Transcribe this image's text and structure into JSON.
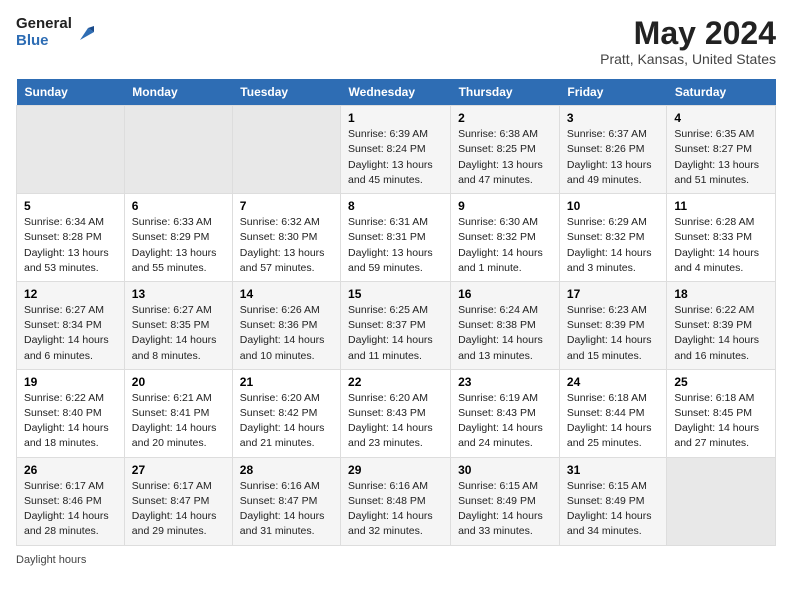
{
  "header": {
    "logo_general": "General",
    "logo_blue": "Blue",
    "month_year": "May 2024",
    "location": "Pratt, Kansas, United States"
  },
  "days_of_week": [
    "Sunday",
    "Monday",
    "Tuesday",
    "Wednesday",
    "Thursday",
    "Friday",
    "Saturday"
  ],
  "weeks": [
    [
      {
        "num": "",
        "info": "",
        "empty": true
      },
      {
        "num": "",
        "info": "",
        "empty": true
      },
      {
        "num": "",
        "info": "",
        "empty": true
      },
      {
        "num": "1",
        "info": "Sunrise: 6:39 AM\nSunset: 8:24 PM\nDaylight: 13 hours\nand 45 minutes.",
        "empty": false
      },
      {
        "num": "2",
        "info": "Sunrise: 6:38 AM\nSunset: 8:25 PM\nDaylight: 13 hours\nand 47 minutes.",
        "empty": false
      },
      {
        "num": "3",
        "info": "Sunrise: 6:37 AM\nSunset: 8:26 PM\nDaylight: 13 hours\nand 49 minutes.",
        "empty": false
      },
      {
        "num": "4",
        "info": "Sunrise: 6:35 AM\nSunset: 8:27 PM\nDaylight: 13 hours\nand 51 minutes.",
        "empty": false
      }
    ],
    [
      {
        "num": "5",
        "info": "Sunrise: 6:34 AM\nSunset: 8:28 PM\nDaylight: 13 hours\nand 53 minutes.",
        "empty": false
      },
      {
        "num": "6",
        "info": "Sunrise: 6:33 AM\nSunset: 8:29 PM\nDaylight: 13 hours\nand 55 minutes.",
        "empty": false
      },
      {
        "num": "7",
        "info": "Sunrise: 6:32 AM\nSunset: 8:30 PM\nDaylight: 13 hours\nand 57 minutes.",
        "empty": false
      },
      {
        "num": "8",
        "info": "Sunrise: 6:31 AM\nSunset: 8:31 PM\nDaylight: 13 hours\nand 59 minutes.",
        "empty": false
      },
      {
        "num": "9",
        "info": "Sunrise: 6:30 AM\nSunset: 8:32 PM\nDaylight: 14 hours\nand 1 minute.",
        "empty": false
      },
      {
        "num": "10",
        "info": "Sunrise: 6:29 AM\nSunset: 8:32 PM\nDaylight: 14 hours\nand 3 minutes.",
        "empty": false
      },
      {
        "num": "11",
        "info": "Sunrise: 6:28 AM\nSunset: 8:33 PM\nDaylight: 14 hours\nand 4 minutes.",
        "empty": false
      }
    ],
    [
      {
        "num": "12",
        "info": "Sunrise: 6:27 AM\nSunset: 8:34 PM\nDaylight: 14 hours\nand 6 minutes.",
        "empty": false
      },
      {
        "num": "13",
        "info": "Sunrise: 6:27 AM\nSunset: 8:35 PM\nDaylight: 14 hours\nand 8 minutes.",
        "empty": false
      },
      {
        "num": "14",
        "info": "Sunrise: 6:26 AM\nSunset: 8:36 PM\nDaylight: 14 hours\nand 10 minutes.",
        "empty": false
      },
      {
        "num": "15",
        "info": "Sunrise: 6:25 AM\nSunset: 8:37 PM\nDaylight: 14 hours\nand 11 minutes.",
        "empty": false
      },
      {
        "num": "16",
        "info": "Sunrise: 6:24 AM\nSunset: 8:38 PM\nDaylight: 14 hours\nand 13 minutes.",
        "empty": false
      },
      {
        "num": "17",
        "info": "Sunrise: 6:23 AM\nSunset: 8:39 PM\nDaylight: 14 hours\nand 15 minutes.",
        "empty": false
      },
      {
        "num": "18",
        "info": "Sunrise: 6:22 AM\nSunset: 8:39 PM\nDaylight: 14 hours\nand 16 minutes.",
        "empty": false
      }
    ],
    [
      {
        "num": "19",
        "info": "Sunrise: 6:22 AM\nSunset: 8:40 PM\nDaylight: 14 hours\nand 18 minutes.",
        "empty": false
      },
      {
        "num": "20",
        "info": "Sunrise: 6:21 AM\nSunset: 8:41 PM\nDaylight: 14 hours\nand 20 minutes.",
        "empty": false
      },
      {
        "num": "21",
        "info": "Sunrise: 6:20 AM\nSunset: 8:42 PM\nDaylight: 14 hours\nand 21 minutes.",
        "empty": false
      },
      {
        "num": "22",
        "info": "Sunrise: 6:20 AM\nSunset: 8:43 PM\nDaylight: 14 hours\nand 23 minutes.",
        "empty": false
      },
      {
        "num": "23",
        "info": "Sunrise: 6:19 AM\nSunset: 8:43 PM\nDaylight: 14 hours\nand 24 minutes.",
        "empty": false
      },
      {
        "num": "24",
        "info": "Sunrise: 6:18 AM\nSunset: 8:44 PM\nDaylight: 14 hours\nand 25 minutes.",
        "empty": false
      },
      {
        "num": "25",
        "info": "Sunrise: 6:18 AM\nSunset: 8:45 PM\nDaylight: 14 hours\nand 27 minutes.",
        "empty": false
      }
    ],
    [
      {
        "num": "26",
        "info": "Sunrise: 6:17 AM\nSunset: 8:46 PM\nDaylight: 14 hours\nand 28 minutes.",
        "empty": false
      },
      {
        "num": "27",
        "info": "Sunrise: 6:17 AM\nSunset: 8:47 PM\nDaylight: 14 hours\nand 29 minutes.",
        "empty": false
      },
      {
        "num": "28",
        "info": "Sunrise: 6:16 AM\nSunset: 8:47 PM\nDaylight: 14 hours\nand 31 minutes.",
        "empty": false
      },
      {
        "num": "29",
        "info": "Sunrise: 6:16 AM\nSunset: 8:48 PM\nDaylight: 14 hours\nand 32 minutes.",
        "empty": false
      },
      {
        "num": "30",
        "info": "Sunrise: 6:15 AM\nSunset: 8:49 PM\nDaylight: 14 hours\nand 33 minutes.",
        "empty": false
      },
      {
        "num": "31",
        "info": "Sunrise: 6:15 AM\nSunset: 8:49 PM\nDaylight: 14 hours\nand 34 minutes.",
        "empty": false
      },
      {
        "num": "",
        "info": "",
        "empty": true
      }
    ]
  ],
  "footer": {
    "daylight_label": "Daylight hours"
  }
}
